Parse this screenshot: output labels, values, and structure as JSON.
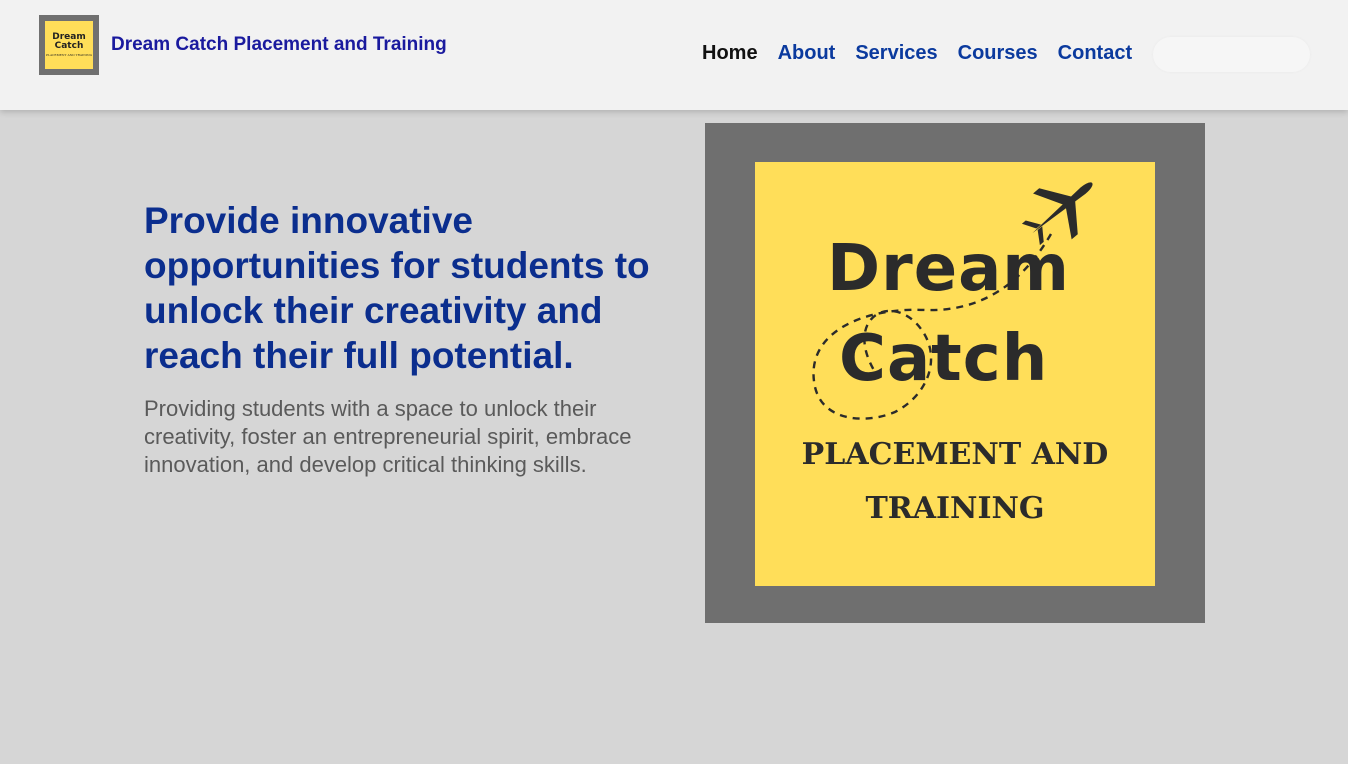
{
  "header": {
    "brand_title": "Dream Catch Placement and Training",
    "logo_text_line1": "Dream",
    "logo_text_line2": "Catch",
    "logo_text_sub": "PLACEMENT AND TRAINING",
    "nav": [
      {
        "label": "Home",
        "active": true
      },
      {
        "label": "About"
      },
      {
        "label": "Services"
      },
      {
        "label": "Courses"
      },
      {
        "label": "Contact"
      }
    ]
  },
  "hero": {
    "heading": "Provide innovative opportunities for students to unlock their creativity and reach their full potential.",
    "subtext": "Providing students with a space to unlock their creativity, foster an entrepreneurial spirit, embrace innovation, and develop critical thinking skills.",
    "image": {
      "word1": "Dream",
      "word2": "Catch",
      "sub_line1": "PLACEMENT AND",
      "sub_line2": "TRAINING",
      "icon": "airplane-icon"
    }
  },
  "colors": {
    "page_bg": "#d6d6d6",
    "header_bg": "#f2f2f2",
    "brand_blue": "#1a1a9e",
    "nav_blue": "#0b3a9e",
    "heading_blue": "#0b2e8e",
    "poster_yellow": "#ffde59",
    "frame_gray": "#6f6f6f"
  }
}
